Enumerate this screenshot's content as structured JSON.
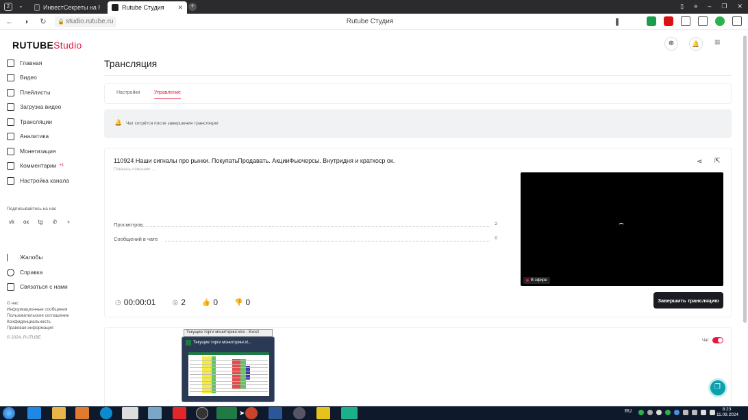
{
  "browser": {
    "tab_count": "2",
    "tabs": [
      {
        "label": "ИнвестСекреты на RUTUB",
        "active": false
      },
      {
        "label": "Rutube Студия",
        "active": true
      }
    ],
    "url": "studio.rutube.ru",
    "page_title": "Rutube Студия"
  },
  "logo": {
    "brand": "RUTUBE",
    "product": "Studio"
  },
  "sidebar": {
    "items": [
      {
        "label": "Главная",
        "icon": "home-icon"
      },
      {
        "label": "Видео",
        "icon": "video-icon"
      },
      {
        "label": "Плейлисты",
        "icon": "playlist-icon"
      },
      {
        "label": "Загрузка видео",
        "icon": "upload-icon"
      },
      {
        "label": "Трансляции",
        "icon": "broadcast-icon"
      },
      {
        "label": "Аналитика",
        "icon": "analytics-icon"
      },
      {
        "label": "Монетизация",
        "icon": "monetization-icon"
      },
      {
        "label": "Комментарии",
        "icon": "comments-icon",
        "badge": "+1"
      },
      {
        "label": "Настройка канала",
        "icon": "channel-settings-icon"
      }
    ],
    "subscribe_label": "Подписывайтесь на нас",
    "social_glyphs": [
      "vk",
      "ок",
      "tg",
      "✆",
      "+"
    ],
    "support": [
      {
        "label": "Жалобы",
        "icon": "flag-icon"
      },
      {
        "label": "Справка",
        "icon": "help-icon"
      },
      {
        "label": "Связаться с нами",
        "icon": "contact-icon"
      }
    ],
    "footer_links": [
      "О нас",
      "Информационные сообщения",
      "Пользовательское соглашение",
      "Конфиденциальность",
      "Правовая информация"
    ],
    "copyright": "© 2024, RUTUBE"
  },
  "main": {
    "title": "Трансляция",
    "tabs": [
      {
        "label": "Настройки",
        "active": false
      },
      {
        "label": "Управление",
        "active": true
      }
    ],
    "notice": "Чат сотрётся после завершения трансляции",
    "stream": {
      "title": "110924 Наши сигналы про рынки. ПокупатьПродавать. АкцииФьючерсы. Внутридня и краткоср ок.",
      "show_description": "Показать описание →",
      "stats": [
        {
          "label": "Просмотров",
          "value": "2"
        },
        {
          "label": "Сообщений в чате",
          "value": "0"
        }
      ],
      "timer": "00:00:01",
      "viewers": "2",
      "likes": "0",
      "dislikes": "0",
      "live_label": "В эфире",
      "end_button": "Завершить трансляцию"
    },
    "chat_toggle_label": "Чат"
  },
  "excel_preview": {
    "tooltip": "Текущие торги мониторинг.xlsx - Excel",
    "window_title": "Текущие торги мониторинг.xl..."
  },
  "taskbar": {
    "lang": "RU",
    "time": "8:23",
    "date": "11.09.2024"
  },
  "colors": {
    "accent": "#e4173f",
    "dark": "#1b1c21",
    "panel": "#f1f2f4",
    "taskbar": "#0e1a2b"
  }
}
